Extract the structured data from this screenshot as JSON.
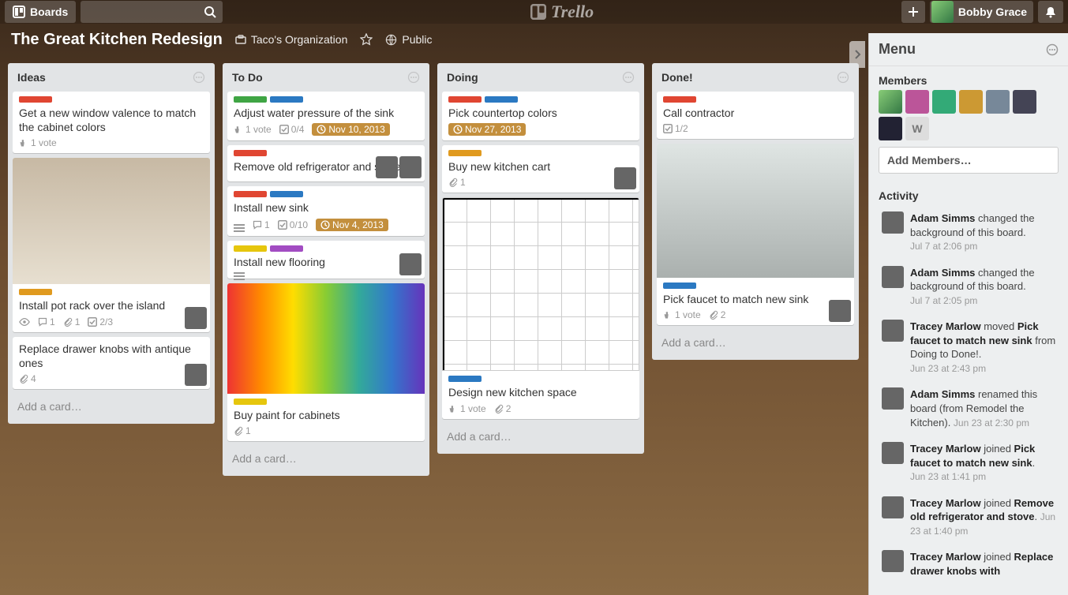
{
  "colors": {
    "red": "#e04632",
    "blue": "#2b79c2",
    "green": "#3fa544",
    "yellow": "#e6c60d",
    "orange": "#e09a1f",
    "purple": "#a24cc2"
  },
  "header": {
    "boards_label": "Boards",
    "logo_text": "Trello",
    "user_name": "Bobby Grace"
  },
  "board": {
    "title": "The Great Kitchen Redesign",
    "org": "Taco's Organization",
    "visibility": "Public"
  },
  "lists": [
    {
      "name": "Ideas",
      "cards": [
        {
          "labels": [
            "red"
          ],
          "title": "Get a new window valence to match the cabinet colors",
          "votes": "1 vote"
        },
        {
          "cover": "pots",
          "labels": [
            "orange"
          ],
          "title": "Install pot rack over the island",
          "watch": true,
          "comments": "1",
          "attachments": "1",
          "checklist": "2/3",
          "members": 1
        },
        {
          "title": "Replace drawer knobs with antique ones",
          "attachments": "4",
          "members": 1
        }
      ]
    },
    {
      "name": "To Do",
      "cards": [
        {
          "labels": [
            "green",
            "blue"
          ],
          "title": "Adjust water pressure of the sink",
          "votes": "1 vote",
          "checklist": "0/4",
          "due": "Nov 10, 2013"
        },
        {
          "labels": [
            "red"
          ],
          "title": "Remove old refrigerator and stove",
          "members": 2
        },
        {
          "labels": [
            "red",
            "blue"
          ],
          "title": "Install new sink",
          "desc": true,
          "comments": "1",
          "checklist": "0/10",
          "due": "Nov 4, 2013"
        },
        {
          "labels": [
            "yellow",
            "purple"
          ],
          "title": "Install new flooring",
          "desc": true,
          "members": 1
        },
        {
          "cover": "paint",
          "labels": [
            "yellow"
          ],
          "title": "Buy paint for cabinets",
          "attachments": "1"
        }
      ]
    },
    {
      "name": "Doing",
      "cards": [
        {
          "labels": [
            "red",
            "blue"
          ],
          "title": "Pick countertop colors",
          "due": "Nov 27, 2013"
        },
        {
          "labels": [
            "orange"
          ],
          "title": "Buy new kitchen cart",
          "attachments": "1",
          "members": 1
        },
        {
          "cover": "plan",
          "labels": [
            "blue"
          ],
          "title": "Design new kitchen space",
          "votes": "1 vote",
          "attachments": "2"
        }
      ]
    },
    {
      "name": "Done!",
      "cards": [
        {
          "labels": [
            "red"
          ],
          "title": "Call contractor",
          "checklist": "1/2"
        },
        {
          "cover": "faucet",
          "labels": [
            "blue"
          ],
          "title": "Pick faucet to match new sink",
          "votes": "1 vote",
          "attachments": "2",
          "members": 1
        }
      ]
    }
  ],
  "add_card": "Add a card…",
  "menu": {
    "title": "Menu",
    "members_title": "Members",
    "members_count": 7,
    "members_initial": "W",
    "add_members": "Add Members…",
    "activity_title": "Activity",
    "activity": [
      {
        "who": "Adam Simms",
        "text": " changed the background of this board.",
        "time": "Jul 7 at 2:06 pm"
      },
      {
        "who": "Adam Simms",
        "text": " changed the background of this board.",
        "time": "Jul 7 at 2:05 pm"
      },
      {
        "who": "Tracey Marlow",
        "text": " moved ",
        "bold": "Pick faucet to match new sink",
        "tail": " from Doing to Done!.",
        "time": "Jun 23 at 2:43 pm"
      },
      {
        "who": "Adam Simms",
        "text": " renamed this board (from Remodel the Kitchen).",
        "time": "Jun 23 at 2:30 pm",
        "inline_time": true
      },
      {
        "who": "Tracey Marlow",
        "text": " joined ",
        "bold": "Pick faucet to match new sink",
        "tail": ".",
        "time": "Jun 23 at 1:41 pm"
      },
      {
        "who": "Tracey Marlow",
        "text": " joined ",
        "bold": "Remove old refrigerator and stove",
        "tail": ".",
        "time": "Jun 23 at 1:40 pm",
        "inline_time": true
      },
      {
        "who": "Tracey Marlow",
        "text": " joined ",
        "bold": "Replace drawer knobs with",
        "tail": "",
        "time": ""
      }
    ]
  }
}
